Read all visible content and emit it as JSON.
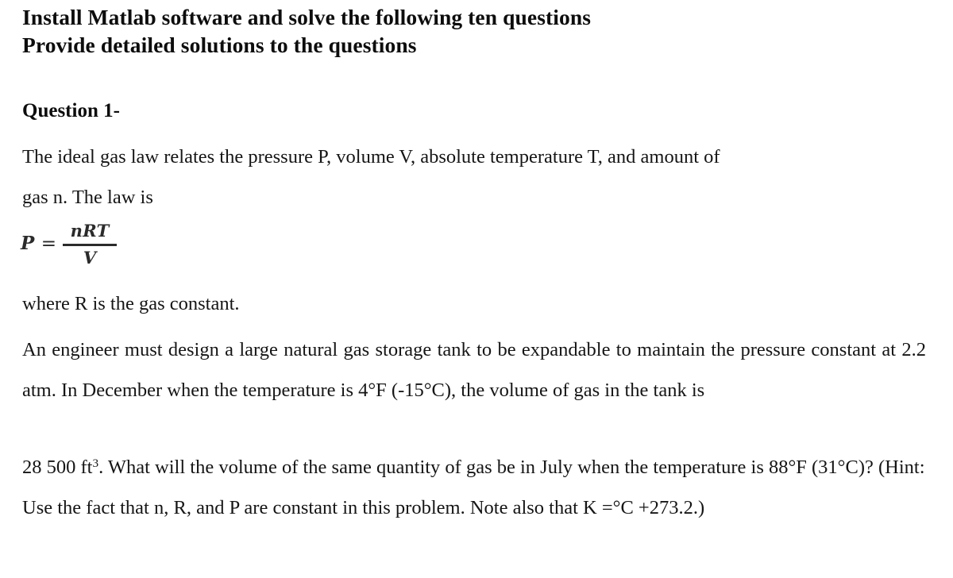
{
  "document": {
    "background_color": "#ffffff",
    "text_color": "#151515",
    "title": {
      "line1": "Install Matlab software and solve the following ten questions",
      "line2": "Provide detailed solutions to the questions"
    },
    "question": {
      "heading": "Question 1-",
      "intro_paragraph": "The ideal gas law relates the pressure P, volume V, absolute temperature T, and amount of gas n. The law is",
      "formula": {
        "lhs": "P",
        "equals": "=",
        "numerator": "nRT",
        "denominator": "V",
        "plain": "P = nRT / V"
      },
      "where_line": "where R is the gas constant.",
      "body_part1": "An engineer must design a large natural gas storage tank to be expandable to maintain the pressure constant at 2.2 atm. In December when the temperature is 4°F (-15°C), the volume of gas in the tank is",
      "body_part2_prefix": "28 500 ft",
      "body_part2_exponent": "3",
      "body_part2_rest": ". What will the volume of the same quantity of gas be in July when the temperature is 88°F (31°C)? (Hint: Use the fact that n, R, and P are constant in this problem. Note also that K =°C +273.2.)"
    }
  }
}
